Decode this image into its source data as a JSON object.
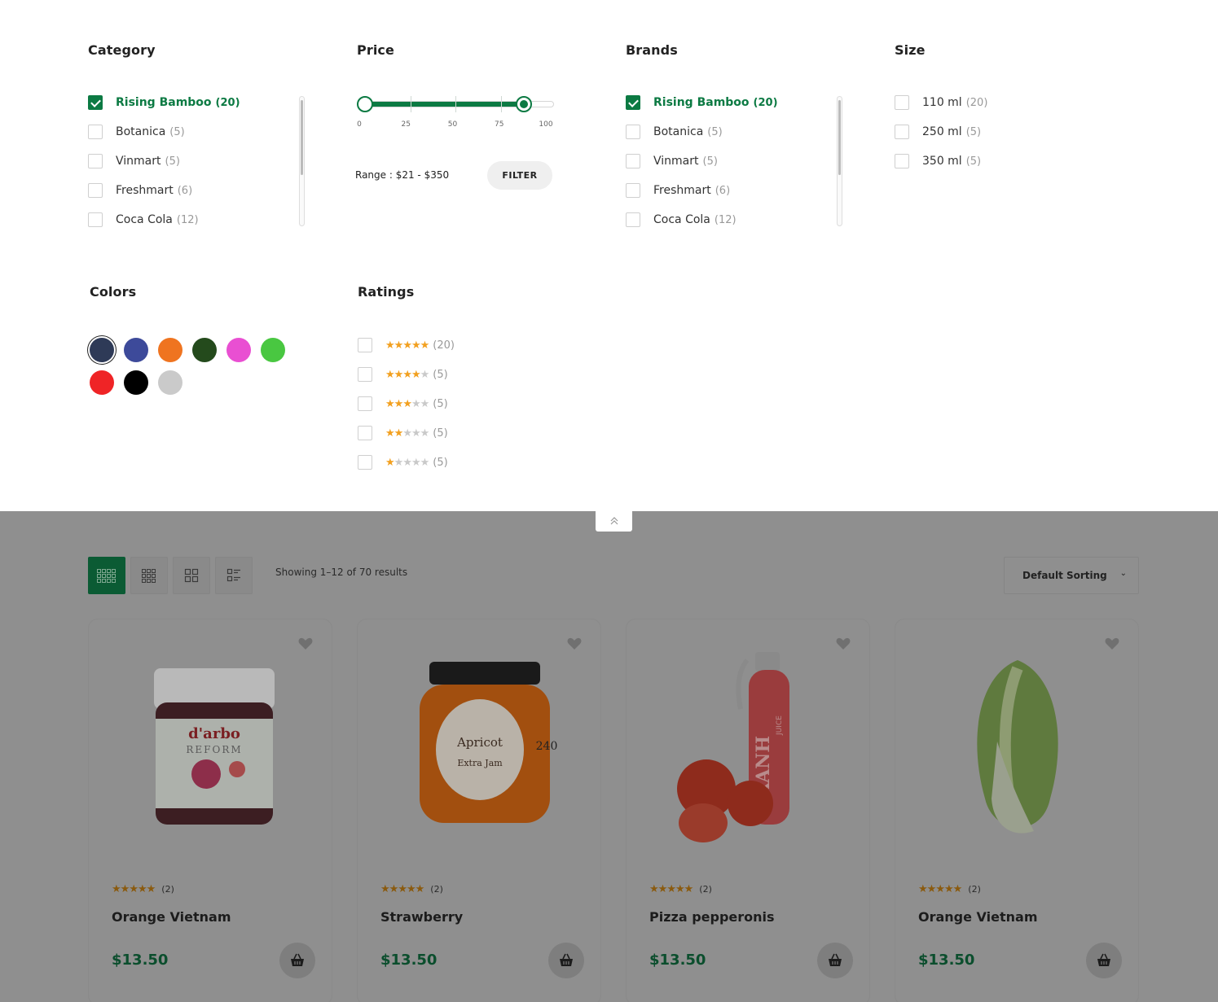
{
  "filters": {
    "category": {
      "title": "Category",
      "items": [
        {
          "label": "Rising Bamboo",
          "count": "(20)",
          "checked": true
        },
        {
          "label": "Botanica",
          "count": "(5)",
          "checked": false
        },
        {
          "label": "Vinmart",
          "count": "(5)",
          "checked": false
        },
        {
          "label": "Freshmart",
          "count": "(6)",
          "checked": false
        },
        {
          "label": "Coca Cola",
          "count": "(12)",
          "checked": false
        }
      ]
    },
    "price": {
      "title": "Price",
      "min": 0,
      "max": 100,
      "selected_low": 0,
      "selected_high": 88,
      "ticks": [
        "0",
        "25",
        "50",
        "75",
        "100"
      ],
      "range_text": "Range : $21 - $350",
      "filter_label": "FILTER"
    },
    "brands": {
      "title": "Brands",
      "items": [
        {
          "label": "Rising Bamboo",
          "count": "(20)",
          "checked": true
        },
        {
          "label": "Botanica",
          "count": "(5)",
          "checked": false
        },
        {
          "label": "Vinmart",
          "count": "(5)",
          "checked": false
        },
        {
          "label": "Freshmart",
          "count": "(6)",
          "checked": false
        },
        {
          "label": "Coca Cola",
          "count": "(12)",
          "checked": false
        }
      ]
    },
    "size": {
      "title": "Size",
      "items": [
        {
          "label": "110 ml",
          "count": "(20)",
          "checked": false
        },
        {
          "label": "250 ml",
          "count": "(5)",
          "checked": false
        },
        {
          "label": "350 ml",
          "count": "(5)",
          "checked": false
        }
      ]
    },
    "colors": {
      "title": "Colors",
      "swatches": [
        "#2e3a57",
        "#3d4a9a",
        "#ef7420",
        "#244a1c",
        "#e94fd2",
        "#49c741",
        "#ef2426",
        "#000000",
        "#cacaca"
      ],
      "selected_index": 0
    },
    "ratings": {
      "title": "Ratings",
      "items": [
        {
          "stars": 5,
          "count": "(20)"
        },
        {
          "stars": 4,
          "count": "(5)"
        },
        {
          "stars": 3,
          "count": "(5)"
        },
        {
          "stars": 2,
          "count": "(5)"
        },
        {
          "stars": 1,
          "count": "(5)"
        }
      ]
    }
  },
  "toolbar": {
    "showing_text": "Showing 1–12 of 70 results",
    "sorting_label": "Default Sorting"
  },
  "products": [
    {
      "name": "Orange Vietnam",
      "price": "$13.50",
      "rating_count": "(2)",
      "stars": 5,
      "image": "jam-jar-raspberry"
    },
    {
      "name": "Strawberry",
      "price": "$13.50",
      "rating_count": "(2)",
      "stars": 5,
      "image": "jam-jar-apricot"
    },
    {
      "name": "Pizza pepperonis",
      "price": "$13.50",
      "rating_count": "(2)",
      "stars": 5,
      "image": "juice-bottle-tomatoes"
    },
    {
      "name": "Orange Vietnam",
      "price": "$13.50",
      "rating_count": "(2)",
      "stars": 5,
      "image": "napa-cabbage"
    }
  ],
  "image_text": {
    "darbo": "d'arbo",
    "reform": "REFORM",
    "apricot": "Apricot",
    "extra_jam": "Extra Jam",
    "jam_weight": "240",
    "xanh": "XANH",
    "juice": "JUICE"
  },
  "colors": {
    "accent": "#0c7a43",
    "star": "#f2a01f",
    "overlay": "#8f8f8f"
  }
}
